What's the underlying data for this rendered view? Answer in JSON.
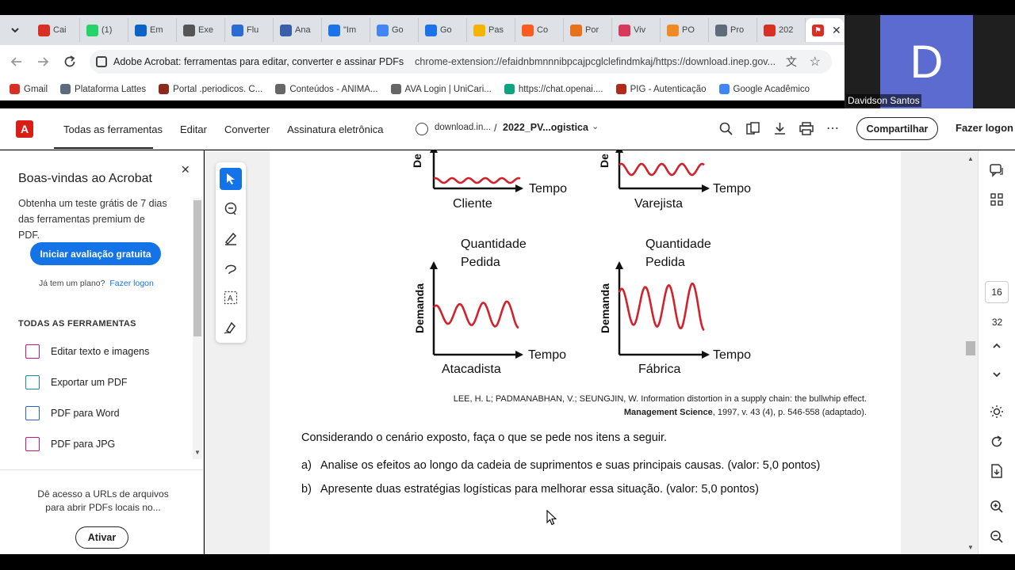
{
  "browser": {
    "tabs": [
      {
        "label": "Cai",
        "icon": "gmail-icon",
        "color": "#d93025"
      },
      {
        "label": "(1)",
        "icon": "whatsapp-icon",
        "color": "#25d366"
      },
      {
        "label": "Em",
        "icon": "outlook-icon",
        "color": "#0a64c8"
      },
      {
        "label": "Exe",
        "icon": "openai-icon",
        "color": "#555555"
      },
      {
        "label": "Flu",
        "icon": "diagram-icon",
        "color": "#2b6cd4"
      },
      {
        "label": "Ana",
        "icon": "ava-icon",
        "color": "#3b5ea8"
      },
      {
        "label": "\"Im",
        "icon": "cap-icon",
        "color": "#1a73e8"
      },
      {
        "label": "Go",
        "icon": "google-translate-icon",
        "color": "#4285f4"
      },
      {
        "label": "Go",
        "icon": "calendar-icon",
        "color": "#1a73e8"
      },
      {
        "label": "Pas",
        "icon": "p-icon",
        "color": "#f4b400"
      },
      {
        "label": "Co",
        "icon": "record-icon",
        "color": "#ff5a1f"
      },
      {
        "label": "Por",
        "icon": "chart-icon",
        "color": "#e8711a"
      },
      {
        "label": "Viv",
        "icon": "vivo-icon",
        "color": "#d8385b"
      },
      {
        "label": "PO",
        "icon": "po-icon",
        "color": "#f08a24"
      },
      {
        "label": "Pro",
        "icon": "pro-icon",
        "color": "#5f6a7a"
      },
      {
        "label": "202",
        "icon": "pdf-icon",
        "color": "#d93025"
      }
    ],
    "address": {
      "site_title": "Adobe Acrobat: ferramentas para editar, converter e assinar PDFs",
      "url": "chrome-extension://efaidnbmnnnibpcajpcglclefindmkaj/https://download.inep.gov..."
    },
    "bookmarks": [
      {
        "label": "Gmail",
        "color": "#d93025"
      },
      {
        "label": "Plataforma Lattes",
        "color": "#5b6b7b"
      },
      {
        "label": "Portal .periodicos. C...",
        "color": "#8b2a1a"
      },
      {
        "label": "Conteúdos - ANIMA...",
        "color": "#666666"
      },
      {
        "label": "AVA Login | UniCari...",
        "color": "#666666"
      },
      {
        "label": "https://chat.openai....",
        "color": "#10a37f"
      },
      {
        "label": "PIG - Autenticação",
        "color": "#b02a1a"
      },
      {
        "label": "Google Acadêmico",
        "color": "#4285f4"
      }
    ]
  },
  "video": {
    "initial": "D",
    "name": "Davidson Santos",
    "bg": "#5b6bd0"
  },
  "acrobat": {
    "nav": [
      "Todas as ferramentas",
      "Editar",
      "Converter",
      "Assinatura eletrônica"
    ],
    "breadcrumb_host": "download.in...",
    "breadcrumb_sep": "/",
    "breadcrumb_file": "2022_PV...ogistica",
    "share_label": "Compartilhar",
    "login_label": "Fazer logon"
  },
  "side_panel": {
    "title": "Boas-vindas ao Acrobat",
    "desc": "Obtenha um teste grátis de 7 dias das ferramentas premium de PDF.",
    "cta": "Iniciar avaliação gratuita",
    "has_plan": "Já tem um plano?",
    "login": "Fazer logon",
    "section": "TODAS AS FERRAMENTAS",
    "tools": [
      "Editar texto e imagens",
      "Exportar um PDF",
      "PDF para Word",
      "PDF para JPG"
    ],
    "footer_text": "Dê acesso a URLs de arquivos para abrir PDFs locais no...",
    "footer_button": "Ativar"
  },
  "page_nav": {
    "current": "16",
    "total": "32"
  },
  "document": {
    "charts": {
      "y_label_top": "De",
      "y_label": "Demanda",
      "x_label": "Tempo",
      "qty_line1": "Quantidade",
      "qty_line2": "Pedida",
      "stage_client": "Cliente",
      "stage_retail": "Varejista",
      "stage_wholesale": "Atacadista",
      "stage_factory": "Fábrica"
    },
    "citation_line1": "LEE, H. L; PADMANABHAN, V.; SEUNGJIN, W. Information distortion in a supply chain: the bullwhip effect.",
    "citation_journal": "Management Science",
    "citation_rest": ", 1997, v. 43 (4), p. 546-558 (adaptado).",
    "prompt": "Considerando o cenário exposto, faça o que se pede nos itens a seguir.",
    "item_a_marker": "a)",
    "item_a": "Analise os efeitos ao longo da cadeia de suprimentos e suas principais causas. (valor: 5,0 pontos)",
    "item_b_marker": "b)",
    "item_b": "Apresente duas estratégias logísticas para melhorar essa situação. (valor: 5,0 pontos)"
  }
}
